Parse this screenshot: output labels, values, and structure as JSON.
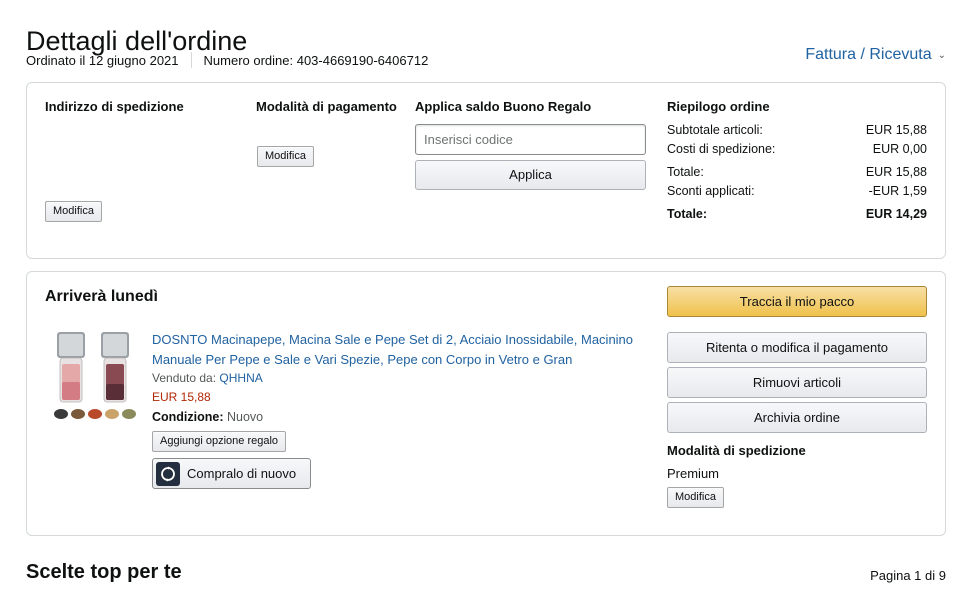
{
  "header": {
    "title": "Dettagli dell'ordine",
    "ordered_on": "Ordinato il 12 giugno 2021",
    "order_number": "Numero ordine: 403-4669190-6406712",
    "invoice_link": "Fattura / Ricevuta"
  },
  "details": {
    "shipping_address_label": "Indirizzo di spedizione",
    "shipping_edit": "Modifica",
    "payment_label": "Modalità di pagamento",
    "payment_edit": "Modifica",
    "gift_card_label": "Applica saldo Buono Regalo",
    "gift_card_placeholder": "Inserisci codice",
    "gift_card_apply": "Applica"
  },
  "summary": {
    "heading": "Riepilogo ordine",
    "rows": [
      {
        "label": "Subtotale articoli:",
        "value": "EUR 15,88"
      },
      {
        "label": "Costi di spedizione:",
        "value": "EUR 0,00"
      },
      {
        "label": "Totale:",
        "value": "EUR 15,88"
      },
      {
        "label": "Sconti applicati:",
        "value": "-EUR 1,59"
      },
      {
        "label": "Totale:",
        "value": "EUR 14,29"
      }
    ]
  },
  "shipment": {
    "arrival": "Arriverà lunedì",
    "product": {
      "title": "DOSNTO  Macinapepe, Macina Sale e Pepe Set di 2, Acciaio Inossidabile, Macinino Manuale Per Pepe e Sale e Vari Spezie, Pepe con Corpo in Vetro e Gran",
      "sold_by_label": "Venduto da: ",
      "seller": "QHHNA",
      "price": "EUR 15,88",
      "condition_label": "Condizione:",
      "condition_value": " Nuovo",
      "gift_option": "Aggiungi opzione regalo",
      "buy_again": "Compralo di nuovo"
    },
    "actions": {
      "track": "Traccia il mio pacco",
      "retry_payment": "Ritenta o modifica il pagamento",
      "remove_items": "Rimuovi articoli",
      "archive": "Archivia ordine"
    },
    "shipping_method_label": "Modalità di spedizione",
    "shipping_method_value": "Premium",
    "shipping_method_edit": "Modifica"
  },
  "recommendations": {
    "title": "Scelte top per te",
    "pagination": "Pagina 1 di 9"
  },
  "colors": {
    "link": "#2162a1",
    "price": "#b12704",
    "primary_button": "#f0c14b",
    "border": "#d5d9d9"
  }
}
